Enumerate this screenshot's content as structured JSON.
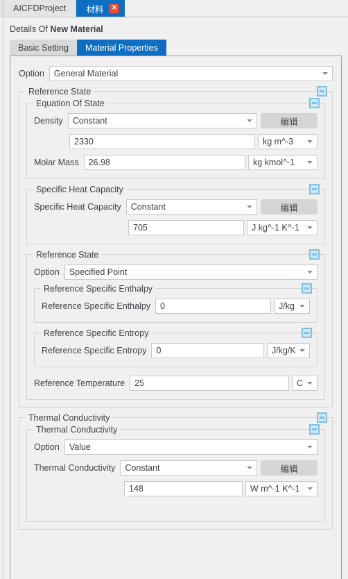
{
  "window_tabs": [
    {
      "label": "AICFDProject",
      "active": false,
      "closable": false
    },
    {
      "label": "材料",
      "active": true,
      "closable": true,
      "close_glyph": "✕"
    }
  ],
  "details": {
    "prefix": "Details Of ",
    "name": "New Material"
  },
  "subtabs": [
    {
      "label": "Basic Setting",
      "active": false
    },
    {
      "label": "Material Properties",
      "active": true
    }
  ],
  "top_option": {
    "label": "Option",
    "value": "General Material"
  },
  "reference_state_group": {
    "title": "Reference State",
    "equation_of_state": {
      "title": "Equation Of State",
      "density": {
        "label": "Density",
        "mode": "Constant",
        "edit_label": "编辑",
        "value": "2330",
        "unit": "kg m^-3"
      },
      "molar_mass": {
        "label": "Molar Mass",
        "value": "26.98",
        "unit": "kg kmol^-1"
      }
    },
    "specific_heat_capacity": {
      "title": "Specific Heat Capacity",
      "label": "Specific Heat Capacity",
      "mode": "Constant",
      "edit_label": "编辑",
      "value": "705",
      "unit": "J kg^-1 K^-1"
    },
    "reference_state_inner": {
      "title": "Reference State",
      "option": {
        "label": "Option",
        "value": "Specified Point"
      },
      "enthalpy": {
        "title": "Reference Specific Enthalpy",
        "label": "Reference Specific Enthalpy",
        "value": "0",
        "unit": "J/kg"
      },
      "entropy": {
        "title": "Reference Specific Entropy",
        "label": "Reference Specific Entropy",
        "value": "0",
        "unit": "J/kg/K"
      },
      "temperature": {
        "label": "Reference Temperature",
        "value": "25",
        "unit": "C"
      }
    }
  },
  "thermal_conductivity_group": {
    "title": "Thermal Conductivity",
    "inner": {
      "title": "Thermal Conductivity",
      "option": {
        "label": "Option",
        "value": "Value"
      },
      "conductivity": {
        "label": "Thermal Conductivity",
        "mode": "Constant",
        "edit_label": "编辑",
        "value": "148",
        "unit": "W m^-1 K^-1"
      }
    }
  },
  "colors": {
    "accent": "#0d6ec4",
    "close_button": "#e8503a",
    "collapse_border": "#7fc0e8",
    "collapse_fill": "#cfe7f7",
    "panel_bg": "#f0f0f0",
    "button_gray": "#d5d5d5"
  }
}
